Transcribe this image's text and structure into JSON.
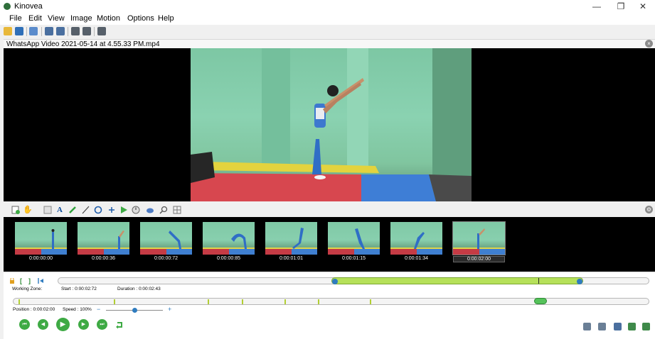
{
  "window": {
    "title": "Kinovea",
    "minimize_glyph": "—",
    "restore_glyph": "❐",
    "close_glyph": "✕"
  },
  "menu": {
    "items": [
      "File",
      "Edit",
      "View",
      "Image",
      "Motion",
      "Options",
      "Help"
    ]
  },
  "toolbar": {
    "icons": [
      "open-folder-icon",
      "save-icon",
      "browser-icon",
      "single-player-icon",
      "dual-player-icon",
      "capture-single-icon",
      "capture-dual-icon",
      "capture-player-icon"
    ]
  },
  "file": {
    "name": "WhatsApp Video 2021-05-14 at 4.55.33 PM.mp4",
    "close_glyph": "×"
  },
  "drawing_tools": {
    "text_tool": "A",
    "settings_glyph": "⚙"
  },
  "thumbnails": [
    {
      "time": "0:00:00:00"
    },
    {
      "time": "0:00:00:36"
    },
    {
      "time": "0:00:00:72"
    },
    {
      "time": "0:00:00:85"
    },
    {
      "time": "0:00:01:01"
    },
    {
      "time": "0:00:01:15"
    },
    {
      "time": "0:00:01:34"
    },
    {
      "time": "0:00:02:00"
    }
  ],
  "working_zone": {
    "label": "Working Zone:",
    "start": "Start : 0:00:02:72",
    "duration": "Duration : 0:00:02:43",
    "markers": [
      "[",
      "]"
    ]
  },
  "playback": {
    "position": "Position : 0:00:02:00",
    "speed": "Speed : 100%",
    "speed_minus": "−",
    "speed_plus": "+",
    "speed_fraction": 0.5
  },
  "colors": {
    "accent_green": "#3eaa44",
    "zone_green": "#b6e15a",
    "handle_blue": "#2f7cbf"
  }
}
